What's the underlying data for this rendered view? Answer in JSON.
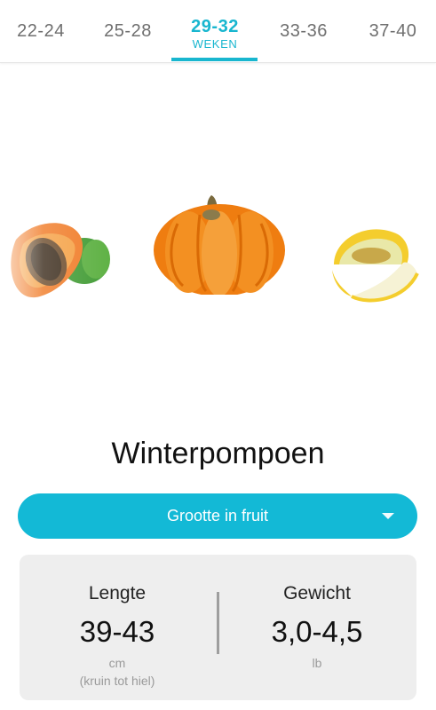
{
  "tabs": [
    {
      "main": "22-24",
      "sub": "",
      "active": false
    },
    {
      "main": "25-28",
      "sub": "",
      "active": false
    },
    {
      "main": "29-32",
      "sub": "WEKEN",
      "active": true
    },
    {
      "main": "33-36",
      "sub": "",
      "active": false
    },
    {
      "main": "37-40",
      "sub": "",
      "active": false
    }
  ],
  "carousel": {
    "items": [
      "papaya-image",
      "winter-squash-image",
      "melon-image"
    ],
    "current": 1
  },
  "fruit": {
    "name": "Winterpompoen"
  },
  "dropdown": {
    "label": "Grootte in fruit"
  },
  "measurements": {
    "length": {
      "label": "Lengte",
      "value": "39-43",
      "unit": "cm",
      "note": "(kruin tot hiel)"
    },
    "weight": {
      "label": "Gewicht",
      "value": "3,0-4,5",
      "unit": "lb"
    }
  },
  "colors": {
    "accent": "#18b6cf",
    "button": "#13b9d6",
    "card": "#eeeeee"
  }
}
